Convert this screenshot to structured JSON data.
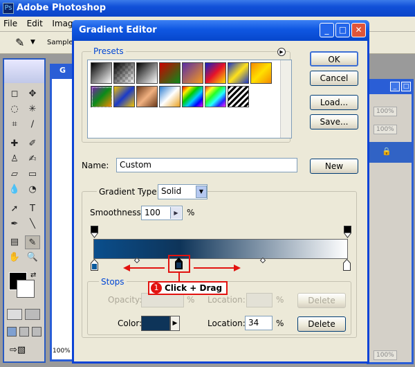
{
  "app": {
    "title": "Adobe Photoshop"
  },
  "menu": [
    "File",
    "Edit",
    "Imag"
  ],
  "options_bar": {
    "sample_label": "Sample S"
  },
  "doc1": {
    "title_fragment": "G",
    "zoom": "100%"
  },
  "layers_panel": {
    "percent_1": "100%",
    "percent_2": "100%",
    "percent_3": "100%"
  },
  "dialog": {
    "title": "Gradient Editor",
    "presets_label": "Presets",
    "buttons": {
      "ok": "OK",
      "cancel": "Cancel",
      "load": "Load...",
      "save": "Save...",
      "new": "New",
      "delete_disabled": "Delete",
      "delete": "Delete"
    },
    "name_label": "Name:",
    "name_value": "Custom",
    "gradient_type_label": "Gradient Type:",
    "gradient_type_value": "Solid",
    "smoothness_label": "Smoothness:",
    "smoothness_value": "100",
    "smoothness_unit": "%",
    "stops_label": "Stops",
    "opacity_label": "Opacity:",
    "opacity_unit": "%",
    "location_label_disabled": "Location:",
    "location_unit_disabled": "%",
    "color_label": "Color:",
    "color_value": "#0e3459",
    "location_label": "Location:",
    "location_value": "34",
    "location_unit": "%"
  },
  "gradient": {
    "start": "#0a4e8c",
    "end": "#ffffff",
    "selected_stop_location": 34
  },
  "callout": {
    "number": "1",
    "text": "Click + Drag"
  },
  "colors": {
    "xp_blue": "#0b43d6",
    "callout_red": "#e2120f"
  }
}
